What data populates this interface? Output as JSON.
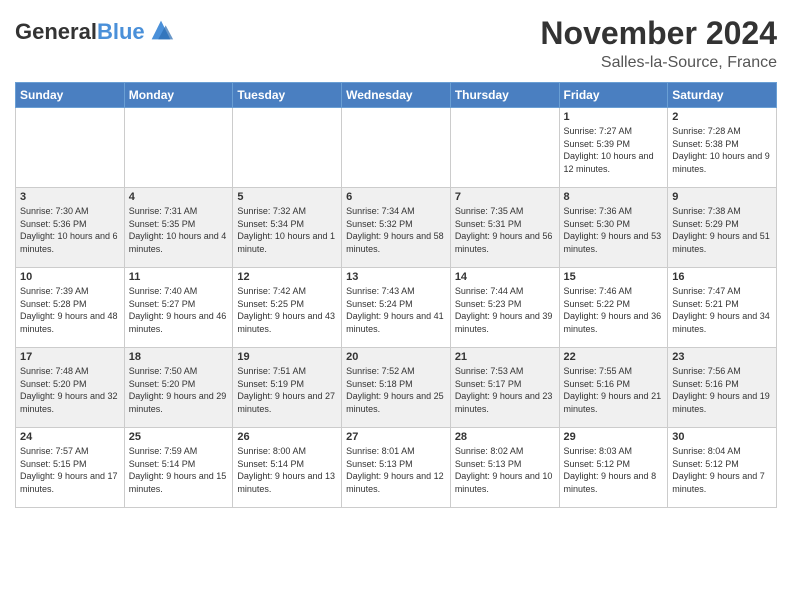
{
  "header": {
    "logo_line1": "General",
    "logo_line2": "Blue",
    "month": "November 2024",
    "location": "Salles-la-Source, France"
  },
  "weekdays": [
    "Sunday",
    "Monday",
    "Tuesday",
    "Wednesday",
    "Thursday",
    "Friday",
    "Saturday"
  ],
  "rows": [
    [
      {
        "day": "",
        "info": ""
      },
      {
        "day": "",
        "info": ""
      },
      {
        "day": "",
        "info": ""
      },
      {
        "day": "",
        "info": ""
      },
      {
        "day": "",
        "info": ""
      },
      {
        "day": "1",
        "info": "Sunrise: 7:27 AM\nSunset: 5:39 PM\nDaylight: 10 hours and 12 minutes."
      },
      {
        "day": "2",
        "info": "Sunrise: 7:28 AM\nSunset: 5:38 PM\nDaylight: 10 hours and 9 minutes."
      }
    ],
    [
      {
        "day": "3",
        "info": "Sunrise: 7:30 AM\nSunset: 5:36 PM\nDaylight: 10 hours and 6 minutes."
      },
      {
        "day": "4",
        "info": "Sunrise: 7:31 AM\nSunset: 5:35 PM\nDaylight: 10 hours and 4 minutes."
      },
      {
        "day": "5",
        "info": "Sunrise: 7:32 AM\nSunset: 5:34 PM\nDaylight: 10 hours and 1 minute."
      },
      {
        "day": "6",
        "info": "Sunrise: 7:34 AM\nSunset: 5:32 PM\nDaylight: 9 hours and 58 minutes."
      },
      {
        "day": "7",
        "info": "Sunrise: 7:35 AM\nSunset: 5:31 PM\nDaylight: 9 hours and 56 minutes."
      },
      {
        "day": "8",
        "info": "Sunrise: 7:36 AM\nSunset: 5:30 PM\nDaylight: 9 hours and 53 minutes."
      },
      {
        "day": "9",
        "info": "Sunrise: 7:38 AM\nSunset: 5:29 PM\nDaylight: 9 hours and 51 minutes."
      }
    ],
    [
      {
        "day": "10",
        "info": "Sunrise: 7:39 AM\nSunset: 5:28 PM\nDaylight: 9 hours and 48 minutes."
      },
      {
        "day": "11",
        "info": "Sunrise: 7:40 AM\nSunset: 5:27 PM\nDaylight: 9 hours and 46 minutes."
      },
      {
        "day": "12",
        "info": "Sunrise: 7:42 AM\nSunset: 5:25 PM\nDaylight: 9 hours and 43 minutes."
      },
      {
        "day": "13",
        "info": "Sunrise: 7:43 AM\nSunset: 5:24 PM\nDaylight: 9 hours and 41 minutes."
      },
      {
        "day": "14",
        "info": "Sunrise: 7:44 AM\nSunset: 5:23 PM\nDaylight: 9 hours and 39 minutes."
      },
      {
        "day": "15",
        "info": "Sunrise: 7:46 AM\nSunset: 5:22 PM\nDaylight: 9 hours and 36 minutes."
      },
      {
        "day": "16",
        "info": "Sunrise: 7:47 AM\nSunset: 5:21 PM\nDaylight: 9 hours and 34 minutes."
      }
    ],
    [
      {
        "day": "17",
        "info": "Sunrise: 7:48 AM\nSunset: 5:20 PM\nDaylight: 9 hours and 32 minutes."
      },
      {
        "day": "18",
        "info": "Sunrise: 7:50 AM\nSunset: 5:20 PM\nDaylight: 9 hours and 29 minutes."
      },
      {
        "day": "19",
        "info": "Sunrise: 7:51 AM\nSunset: 5:19 PM\nDaylight: 9 hours and 27 minutes."
      },
      {
        "day": "20",
        "info": "Sunrise: 7:52 AM\nSunset: 5:18 PM\nDaylight: 9 hours and 25 minutes."
      },
      {
        "day": "21",
        "info": "Sunrise: 7:53 AM\nSunset: 5:17 PM\nDaylight: 9 hours and 23 minutes."
      },
      {
        "day": "22",
        "info": "Sunrise: 7:55 AM\nSunset: 5:16 PM\nDaylight: 9 hours and 21 minutes."
      },
      {
        "day": "23",
        "info": "Sunrise: 7:56 AM\nSunset: 5:16 PM\nDaylight: 9 hours and 19 minutes."
      }
    ],
    [
      {
        "day": "24",
        "info": "Sunrise: 7:57 AM\nSunset: 5:15 PM\nDaylight: 9 hours and 17 minutes."
      },
      {
        "day": "25",
        "info": "Sunrise: 7:59 AM\nSunset: 5:14 PM\nDaylight: 9 hours and 15 minutes."
      },
      {
        "day": "26",
        "info": "Sunrise: 8:00 AM\nSunset: 5:14 PM\nDaylight: 9 hours and 13 minutes."
      },
      {
        "day": "27",
        "info": "Sunrise: 8:01 AM\nSunset: 5:13 PM\nDaylight: 9 hours and 12 minutes."
      },
      {
        "day": "28",
        "info": "Sunrise: 8:02 AM\nSunset: 5:13 PM\nDaylight: 9 hours and 10 minutes."
      },
      {
        "day": "29",
        "info": "Sunrise: 8:03 AM\nSunset: 5:12 PM\nDaylight: 9 hours and 8 minutes."
      },
      {
        "day": "30",
        "info": "Sunrise: 8:04 AM\nSunset: 5:12 PM\nDaylight: 9 hours and 7 minutes."
      }
    ]
  ]
}
